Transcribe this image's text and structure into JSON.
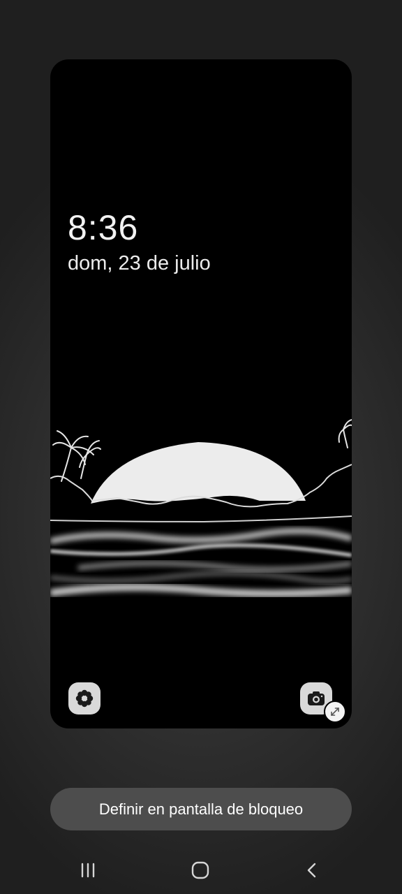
{
  "lock_screen_preview": {
    "time": "8:36",
    "date": "dom, 23 de julio",
    "left_shortcut_icon": "flower-icon",
    "right_shortcut_icon": "camera-icon",
    "expand_icon": "expand-arrows-icon"
  },
  "actions": {
    "set_lock_screen_label": "Definir en pantalla de bloqueo"
  },
  "navigation_bar": {
    "recent_icon": "recent-apps-icon",
    "home_icon": "home-icon",
    "back_icon": "back-chevron-icon"
  }
}
